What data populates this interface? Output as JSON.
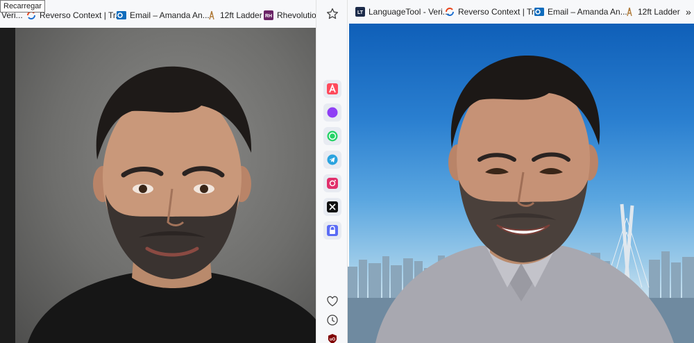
{
  "left_window": {
    "tooltip": "Recarregar",
    "bookmarks": [
      {
        "label": "Veri...",
        "icon": "languagetool-icon"
      },
      {
        "label": "Reverso Context | Tr...",
        "icon": "reverso-icon"
      },
      {
        "label": "Email – Amanda An...",
        "icon": "outlook-icon"
      },
      {
        "label": "12ft Ladder",
        "icon": "ladder-icon"
      },
      {
        "label": "Rhevolution",
        "icon": "rhevolution-icon"
      }
    ]
  },
  "sidebar": {
    "apps": [
      "aria-icon",
      "messenger-icon",
      "whatsapp-icon",
      "telegram-icon",
      "instagram-icon",
      "x-twitter-icon",
      "vpn-icon"
    ],
    "top_icon": "star-icon",
    "bottom_icons": [
      "heart-icon",
      "clock-icon",
      "ublock-icon"
    ]
  },
  "right_window": {
    "bookmarks": [
      {
        "label": "LanguageTool - Veri...",
        "icon": "languagetool-icon"
      },
      {
        "label": "Reverso Context | Tr...",
        "icon": "reverso-icon"
      },
      {
        "label": "Email – Amanda An...",
        "icon": "outlook-icon"
      },
      {
        "label": "12ft Ladder",
        "icon": "ladder-icon"
      }
    ],
    "overflow": "»"
  },
  "colors": {
    "toolbar_bg": "#f7f8fa",
    "sky_top": "#0f5fb8",
    "wall_gray": "#7a7a78",
    "outlook_blue": "#0f6cbd",
    "rhevolution_purple": "#6b2466"
  }
}
